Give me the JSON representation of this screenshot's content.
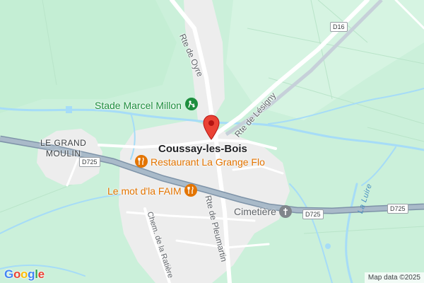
{
  "map": {
    "place_marker": "Coussay-les-Bois",
    "town_label": "Coussay-les-Bois",
    "hamlet_label_line1": "LE GRAND",
    "hamlet_label_line2": "MOULIN",
    "road_labels": {
      "rte_oyre": "Rte de Oyre",
      "rte_lesigny": "Rte de Lésigny",
      "rte_pleumartin": "Rte de Pleumartin",
      "chem_ratiere": "Chem. de la Ratière"
    },
    "road_shields": {
      "d16": "D16",
      "d725_west": "D725",
      "d725_mid": "D725",
      "d725_east": "D725"
    },
    "pois": {
      "stadium": "Stade Marcel Millon",
      "restaurant_grange": "Restaurant La Grange Flo",
      "restaurant_faim": "Le mot d'la FAIM",
      "cemetery": "Cimetière"
    },
    "river_label": "La Luire",
    "colors": {
      "land": "#cbf0da",
      "built_area": "#ededed",
      "water": "#a6dcf7",
      "highway": "#8fa3b6",
      "food_poi": "#e37400",
      "park_poi": "#1e8e3e",
      "pin": "#ea4335"
    }
  },
  "footer": {
    "logo": "Google",
    "attribution": "Map data ©2025"
  }
}
